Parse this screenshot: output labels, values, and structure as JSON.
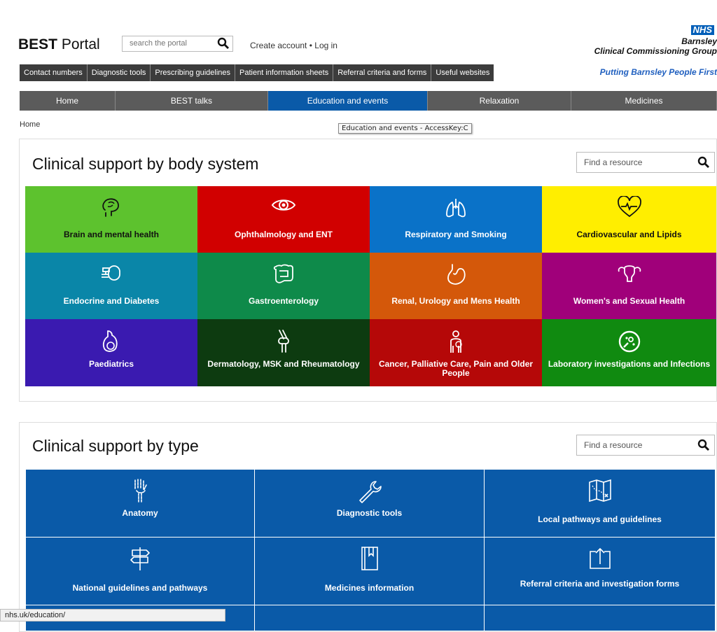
{
  "header": {
    "brand_bold": "BEST",
    "brand_rest": " Portal",
    "search_placeholder": "search the portal",
    "create_account": "Create account",
    "separator": " • ",
    "login": "Log in",
    "nhs_logo": "NHS",
    "org_line1": "Barnsley",
    "org_line2": "Clinical Commissioning Group",
    "tagline": "Putting Barnsley People First"
  },
  "top_links": [
    "Contact numbers",
    "Diagnostic tools",
    "Prescribing guidelines",
    "Patient information sheets",
    "Referral criteria and forms",
    "Useful websites"
  ],
  "main_nav": [
    {
      "label": "Home",
      "active": false
    },
    {
      "label": "BEST talks",
      "active": false
    },
    {
      "label": "Education and events",
      "active": true
    },
    {
      "label": "Relaxation",
      "active": false
    },
    {
      "label": "Medicines",
      "active": false
    }
  ],
  "breadcrumb": "Home",
  "tooltip": "Education and events - AccessKey:C",
  "body_system": {
    "title": "Clinical support by body system",
    "find_placeholder": "Find a resource",
    "tiles": [
      {
        "label": "Brain and mental health",
        "color": "#5dc22e",
        "label_color": "#111111",
        "icon": "brain-icon"
      },
      {
        "label": "Ophthalmology and ENT",
        "color": "#d10000",
        "label_color": "#ffffff",
        "icon": "eye-icon"
      },
      {
        "label": "Respiratory and Smoking",
        "color": "#0a72c8",
        "label_color": "#ffffff",
        "icon": "lungs-icon"
      },
      {
        "label": "Cardiovascular and Lipids",
        "color": "#ffee00",
        "label_color": "#111111",
        "icon": "heart-icon"
      },
      {
        "label": "Endocrine and Diabetes",
        "color": "#0a86a8",
        "label_color": "#ffffff",
        "icon": "pump-icon"
      },
      {
        "label": "Gastroenterology",
        "color": "#0e8a4a",
        "label_color": "#ffffff",
        "icon": "intestine-icon"
      },
      {
        "label": "Renal, Urology and Mens Health",
        "color": "#d4580a",
        "label_color": "#ffffff",
        "icon": "stomach-icon"
      },
      {
        "label": "Women's and Sexual Health",
        "color": "#a0007a",
        "label_color": "#ffffff",
        "icon": "uterus-icon"
      },
      {
        "label": "Paediatrics",
        "color": "#3a1ab0",
        "label_color": "#ffffff",
        "icon": "baby-icon"
      },
      {
        "label": "Dermatology, MSK and Rheumatology",
        "color": "#0d3b10",
        "label_color": "#ffffff",
        "icon": "knee-icon"
      },
      {
        "label": "Cancer, Palliative Care, Pain and Older People",
        "color": "#b50808",
        "label_color": "#ffffff",
        "icon": "person-icon"
      },
      {
        "label": "Laboratory investigations and Infections",
        "color": "#108a10",
        "label_color": "#ffffff",
        "icon": "microbe-icon"
      }
    ]
  },
  "by_type": {
    "title": "Clinical support by type",
    "find_placeholder": "Find a resource",
    "tiles": [
      {
        "label": "Anatomy",
        "icon": "skeleton-hand-icon"
      },
      {
        "label": "Diagnostic tools",
        "icon": "wrench-icon"
      },
      {
        "label": "Local pathways and guidelines",
        "icon": "map-icon"
      },
      {
        "label": "National guidelines and pathways",
        "icon": "signpost-icon"
      },
      {
        "label": "Medicines information",
        "icon": "book-icon"
      },
      {
        "label": "Referral criteria and investigation forms",
        "icon": "upload-icon"
      }
    ],
    "color": "#0a5aa8"
  },
  "status_bar": "nhs.uk/education/"
}
